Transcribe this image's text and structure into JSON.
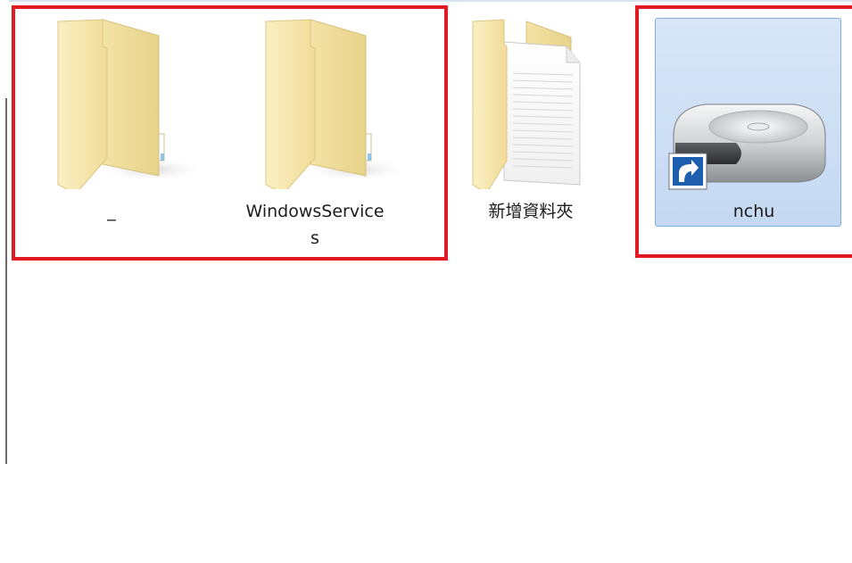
{
  "items": [
    {
      "label": "_",
      "type": "folder",
      "icon": "folder-icon"
    },
    {
      "label": "WindowsService\ns",
      "type": "folder",
      "icon": "folder-icon"
    },
    {
      "label": "新增資料夾",
      "type": "folder-with-document",
      "icon": "folder-document-icon"
    },
    {
      "label": "nchu",
      "type": "drive-shortcut",
      "icon": "drive-shortcut-icon",
      "selected": true
    }
  ],
  "colors": {
    "highlight": "#e01b24",
    "selection_bg": "#cfe0f5",
    "selection_border": "#84acdd",
    "folder": "#f7e6a7"
  }
}
